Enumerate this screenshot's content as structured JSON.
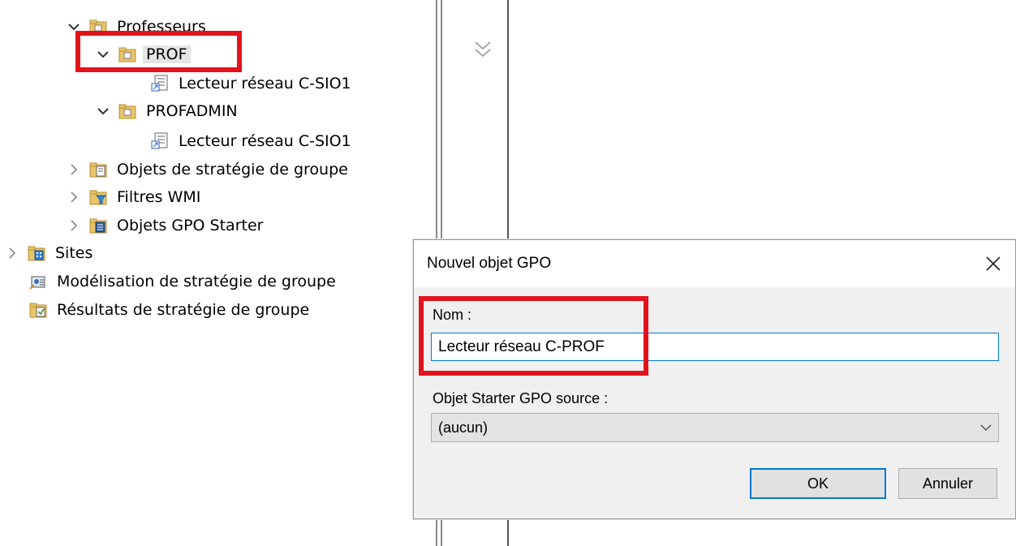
{
  "tree": {
    "items": [
      {
        "label": "Professeurs",
        "icon": "folder-ou-icon",
        "expanded": true
      },
      {
        "label": "PROF",
        "icon": "folder-ou-icon",
        "expanded": true,
        "selected": true
      },
      {
        "label": "Lecteur réseau C-SIO1",
        "icon": "gpo-link-icon"
      },
      {
        "label": "PROFADMIN",
        "icon": "folder-ou-icon",
        "expanded": true
      },
      {
        "label": "Lecteur réseau C-SIO1",
        "icon": "gpo-link-icon"
      },
      {
        "label": "Objets de stratégie de groupe",
        "icon": "gpo-container-icon",
        "expanded": false
      },
      {
        "label": "Filtres WMI",
        "icon": "wmi-filter-icon",
        "expanded": false
      },
      {
        "label": "Objets GPO Starter",
        "icon": "starter-gpo-icon",
        "expanded": false
      },
      {
        "label": "Sites",
        "icon": "sites-icon",
        "expanded": false
      },
      {
        "label": "Modélisation de stratégie de groupe",
        "icon": "gp-modeling-icon"
      },
      {
        "label": "Résultats de stratégie de groupe",
        "icon": "gp-results-icon"
      }
    ]
  },
  "dialog": {
    "title": "Nouvel objet GPO",
    "name_label": "Nom :",
    "name_value": "Lecteur réseau C-PROF",
    "starter_label": "Objet Starter GPO source :",
    "starter_selected": "(aucun)",
    "ok_label": "OK",
    "cancel_label": "Annuler"
  },
  "colors": {
    "highlight": "#e3121d",
    "focus_blue": "#0078d7",
    "dialog_bg": "#f0f0f0"
  }
}
